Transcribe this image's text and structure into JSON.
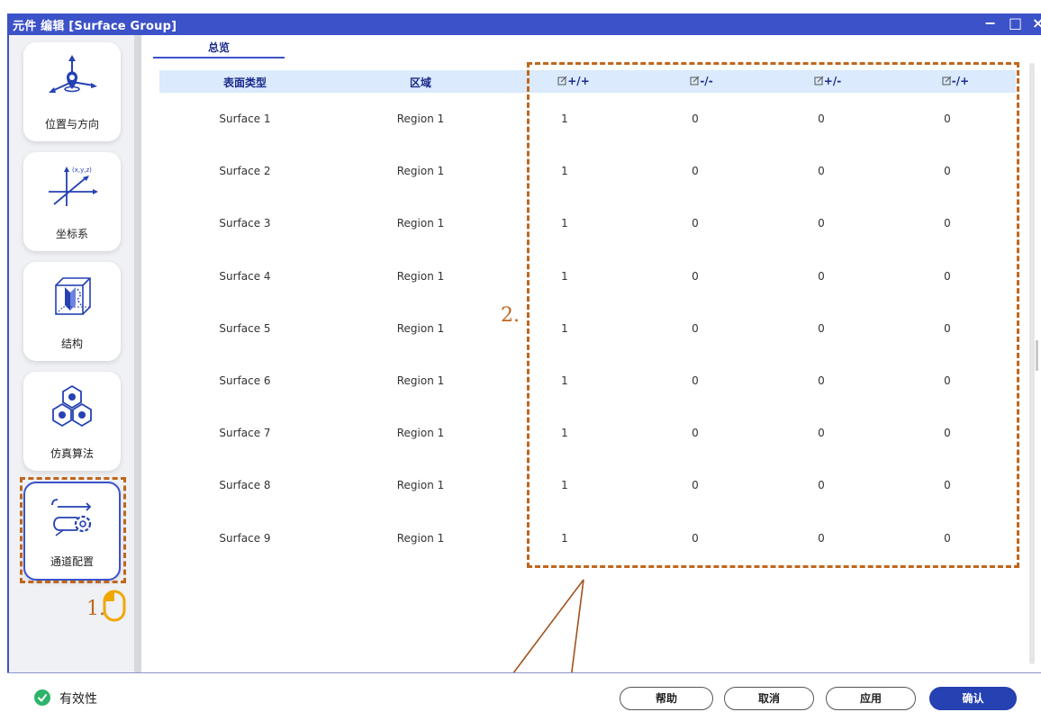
{
  "window": {
    "title": "元件 编辑 [Surface Group]",
    "minimize_glyph": "−",
    "maximize_glyph": "□",
    "close_glyph": "×"
  },
  "sidebar": {
    "items": [
      {
        "label": "位置与方向",
        "icon": "position-direction-icon"
      },
      {
        "label": "坐标系",
        "icon": "coordinate-system-icon",
        "axis_text": "(x,y,z)"
      },
      {
        "label": "结构",
        "icon": "structure-cube-icon"
      },
      {
        "label": "仿真算法",
        "icon": "simulation-algorithm-icon"
      },
      {
        "label": "通道配置",
        "icon": "channel-config-icon",
        "active": true
      }
    ]
  },
  "tabs": [
    {
      "label": "总览",
      "active": true
    }
  ],
  "table": {
    "columns": [
      "表面类型",
      "区域",
      "+/+",
      "-/-",
      "+/-",
      "-/+"
    ],
    "rows": [
      [
        "Surface 1",
        "Region 1",
        "1",
        "0",
        "0",
        "0"
      ],
      [
        "Surface 2",
        "Region 1",
        "1",
        "0",
        "0",
        "0"
      ],
      [
        "Surface 3",
        "Region 1",
        "1",
        "0",
        "0",
        "0"
      ],
      [
        "Surface 4",
        "Region 1",
        "1",
        "0",
        "0",
        "0"
      ],
      [
        "Surface 5",
        "Region 1",
        "1",
        "0",
        "0",
        "0"
      ],
      [
        "Surface 6",
        "Region 1",
        "1",
        "0",
        "0",
        "0"
      ],
      [
        "Surface 7",
        "Region 1",
        "1",
        "0",
        "0",
        "0"
      ],
      [
        "Surface 8",
        "Region 1",
        "1",
        "0",
        "0",
        "0"
      ],
      [
        "Surface 9",
        "Region 1",
        "1",
        "0",
        "0",
        "0"
      ]
    ]
  },
  "footer": {
    "validity_label": "有效性",
    "buttons": {
      "help": "帮助",
      "cancel": "取消",
      "apply": "应用",
      "confirm": "确认"
    }
  },
  "annotations": {
    "step1": "1.",
    "step2": "2."
  },
  "colors": {
    "accent": "#3c52c8",
    "header_bg": "#dbeafd",
    "annotation": "#c0661c",
    "valid_green": "#2db46a",
    "primary_button": "#2541b2"
  }
}
